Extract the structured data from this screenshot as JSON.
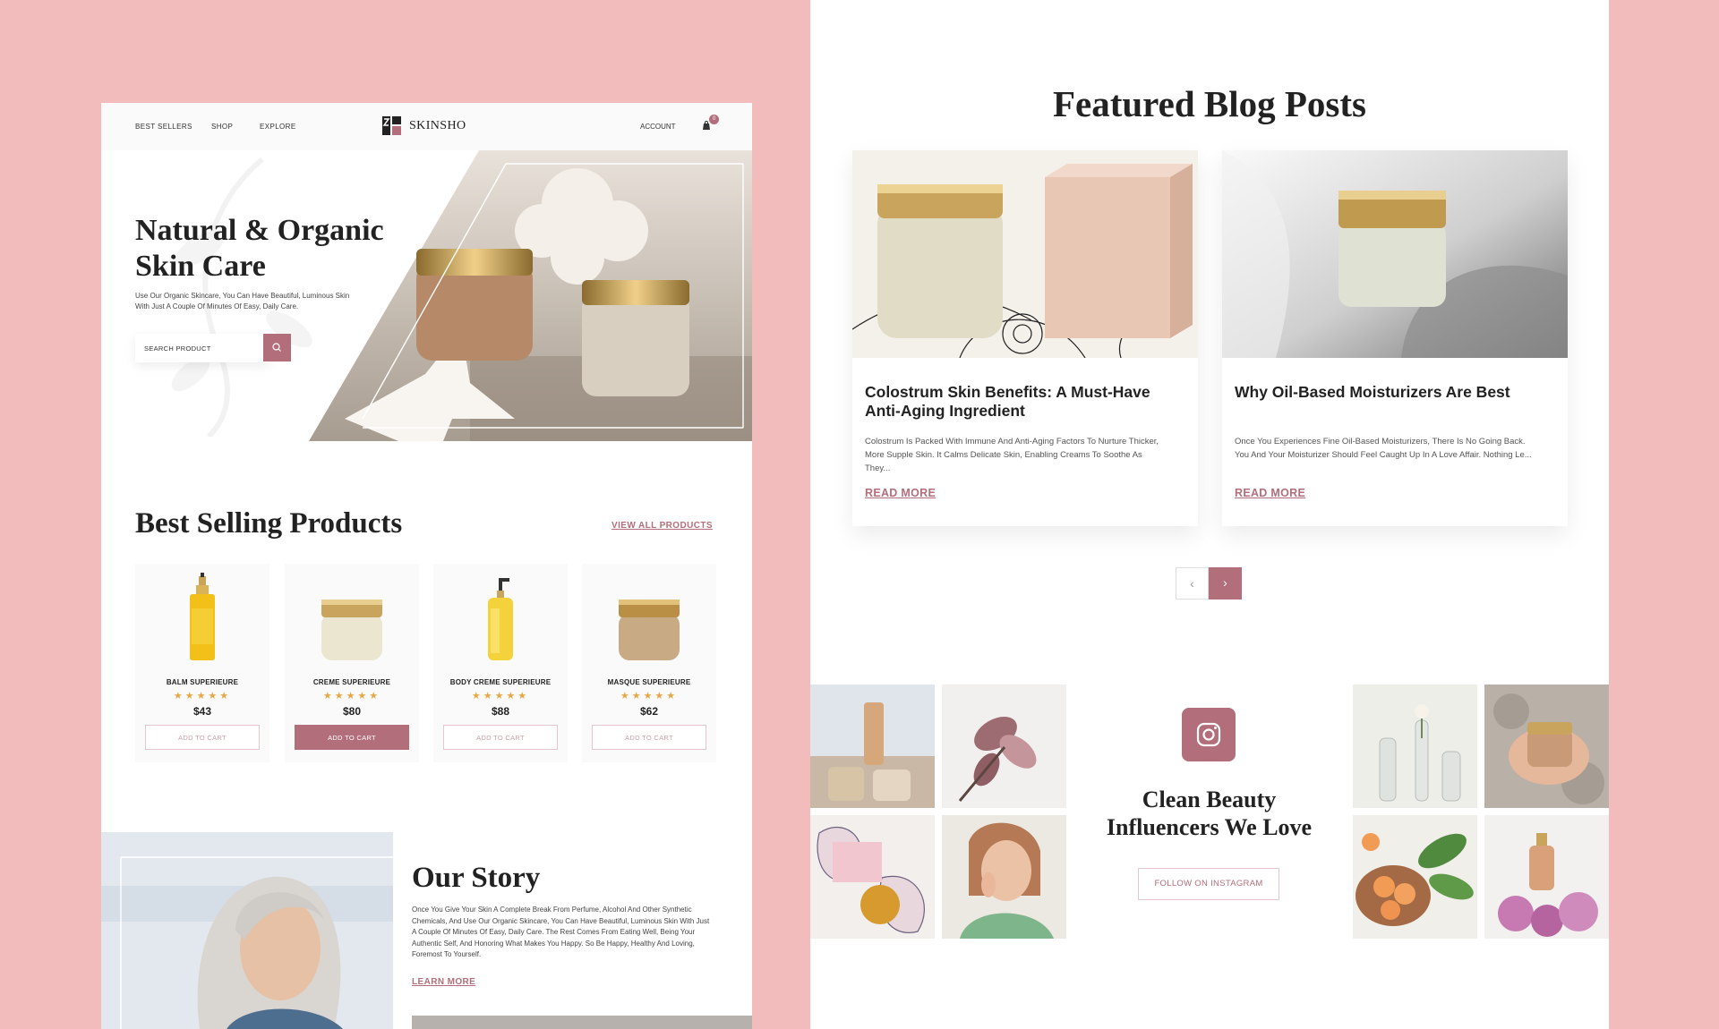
{
  "left_page": {
    "nav": {
      "links": [
        "BEST SELLERS",
        "SHOP",
        "EXPLORE"
      ],
      "brand": "SKINSHO",
      "account": "ACCOUNT",
      "cart_count": "0"
    },
    "hero": {
      "title_line1": "Natural & Organic",
      "title_line2": "Skin Care",
      "subtitle": "Use Our Organic Skincare, You Can Have Beautiful, Luminous Skin With Just A Couple Of Minutes Of Easy, Daily Care.",
      "search_placeholder": "SEARCH PRODUCT"
    },
    "best_selling": {
      "title": "Best Selling Products",
      "view_all": "VIEW ALL PRODUCTS",
      "products": [
        {
          "name": "BALM SUPERIEURE",
          "price": "$43",
          "button": "ADD TO CART",
          "rating": 5
        },
        {
          "name": "CREME SUPERIEURE",
          "price": "$80",
          "button": "ADD TO CART",
          "rating": 5
        },
        {
          "name": "BODY CREME SUPERIEURE",
          "price": "$88",
          "button": "ADD TO CART",
          "rating": 5
        },
        {
          "name": "MASQUE SUPERIEURE",
          "price": "$62",
          "button": "ADD TO CART",
          "rating": 5
        }
      ]
    },
    "story": {
      "title": "Our Story",
      "text": "Once You Give Your Skin A Complete Break From Perfume, Alcohol And Other Synthetic Chemicals, And Use Our Organic Skincare, You Can Have Beautiful, Luminous Skin With Just A Couple Of Minutes Of Easy, Daily Care. The Rest Comes From Eating Well, Being Your Authentic Self, And Honoring What Makes You Happy. So Be Happy, Healthy And Loving, Foremost To Yourself.",
      "learn_more": "LEARN MORE"
    }
  },
  "right_page": {
    "blog": {
      "title": "Featured Blog Posts",
      "posts": [
        {
          "title": "Colostrum Skin Benefits: A Must-Have Anti-Aging Ingredient",
          "excerpt": "Colostrum Is Packed With Immune And Anti-Aging Factors To Nurture Thicker, More Supple Skin. It Calms Delicate Skin, Enabling Creams To Soothe As They...",
          "read_more": "READ MORE"
        },
        {
          "title": "Why Oil-Based Moisturizers Are Best",
          "excerpt": "Once You Experiences Fine Oil-Based Moisturizers, There Is No Going Back. You And Your Moisturizer Should Feel Caught Up In A Love Affair. Nothing Le...",
          "read_more": "READ MORE"
        }
      ],
      "prev_glyph": "‹",
      "next_glyph": "›"
    },
    "instagram": {
      "title_line1": "Clean Beauty",
      "title_line2": "Influencers We Love",
      "follow_button": "FOLLOW ON INSTAGRAM"
    }
  },
  "colors": {
    "background": "#f3bcbc",
    "accent": "#b26e7a",
    "star": "#e6a845"
  }
}
